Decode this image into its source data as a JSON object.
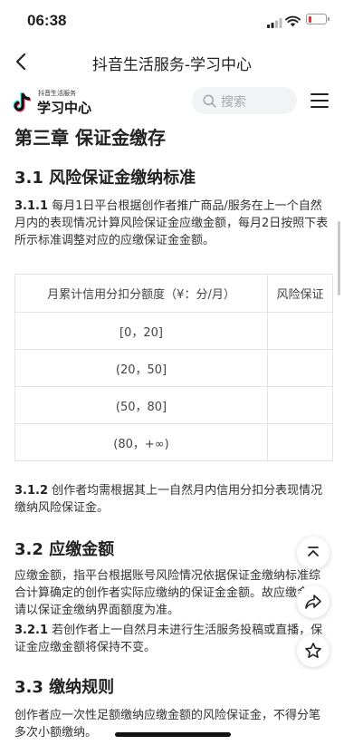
{
  "status_bar": {
    "time": "06:38"
  },
  "nav": {
    "title": "抖音生活服务-学习中心"
  },
  "header": {
    "logo_small": "抖音生活服务",
    "logo_big": "学习中心",
    "search_placeholder": "搜索"
  },
  "article": {
    "chapter_title": "第三章 保证金缴存",
    "s31_title": "3.1 风险保证金缴纳标准",
    "p311_num": "3.1.1",
    "p311_text": " 每月1日平台根据创作者推广商品/服务在上一个自然月内的表现情况计算风险保证金应缴金额，每月2日按照下表所示标准调整对应的应缴保证金金额。",
    "table": {
      "headers": [
        "月累计信用分扣分额度（¥：分/月）",
        "风险保证"
      ],
      "rows": [
        [
          "[0，20]",
          ""
        ],
        [
          "(20，50]",
          ""
        ],
        [
          "(50，80]",
          ""
        ],
        [
          "(80，+∞)",
          ""
        ]
      ]
    },
    "p312_num": "3.1.2",
    "p312_text": " 创作者均需根据其上一自然月内信用分扣分表现情况缴纳风险保证金。",
    "s32_title": "3.2 应缴金额",
    "p32_text": "应缴金额，指平台根据账号风险情况依据保证金缴纳标准综合计算确定的创作者实际应缴纳的保证金金额。故应缴金额请以保证金缴纳界面额度为准。",
    "p321_num": "3.2.1",
    "p321_text": " 若创作者上一自然月未进行生活服务投稿或直播，保证金应缴金额将保持不变。",
    "s33_title": "3.3 缴纳规则",
    "p33_text": "创作者应一次性足额缴纳应缴金额的风险保证金，不得分笔多次小额缴纳。"
  },
  "colors": {
    "accent_red": "#e5322d",
    "logo_cyan": "#25f4ee",
    "logo_pink": "#fe2c55"
  },
  "icons": [
    "back-arrow-icon",
    "search-icon",
    "menu-icon",
    "scroll-top-icon",
    "share-icon",
    "star-icon",
    "douyin-logo-icon"
  ]
}
